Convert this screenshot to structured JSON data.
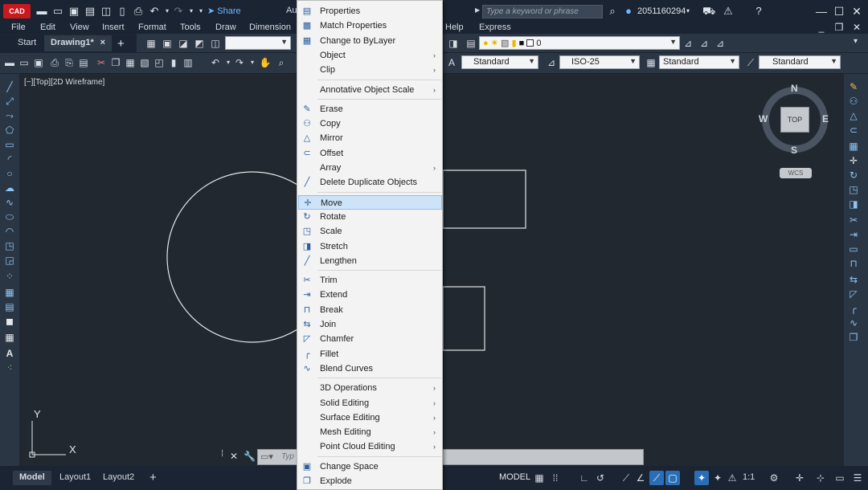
{
  "app": {
    "logo_text": "CAD",
    "title_fragment": "Au",
    "share_label": "Share",
    "search_placeholder": "Type a keyword or phrase",
    "user_id": "2051160294"
  },
  "menubar": [
    "File",
    "Edit",
    "View",
    "Insert",
    "Format",
    "Tools",
    "Draw",
    "Dimension",
    "Help",
    "Express"
  ],
  "tabs": {
    "start": "Start",
    "drawing": "Drawing1*",
    "close": "×",
    "add": "+"
  },
  "toolbar": {
    "layer_value": "0",
    "text_style": "Standard",
    "dim_style": "ISO-25",
    "table_style": "Standard",
    "multileader_style": "Standard"
  },
  "viewport_label": "[−][Top][2D Wireframe]",
  "viewcube": {
    "north": "N",
    "south": "S",
    "east": "E",
    "west": "W",
    "face": "TOP",
    "wcs": "WCS"
  },
  "ucs": {
    "x": "X",
    "y": "Y"
  },
  "command_line": {
    "placeholder": "Typ"
  },
  "layout_tabs": [
    "Model",
    "Layout1",
    "Layout2"
  ],
  "status": {
    "model": "MODEL",
    "scale": "1:1"
  },
  "context_menu": {
    "items": [
      {
        "label": "Properties",
        "icon": "properties-icon",
        "glyph": "▤",
        "submenu": false
      },
      {
        "label": "Match Properties",
        "icon": "match-properties-icon",
        "glyph": "▩",
        "submenu": false
      },
      {
        "label": "Change to ByLayer",
        "icon": "bylayer-icon",
        "glyph": "▦",
        "submenu": false
      },
      {
        "label": "Object",
        "icon": "",
        "glyph": "",
        "submenu": true
      },
      {
        "label": "Clip",
        "icon": "",
        "glyph": "",
        "submenu": true
      },
      {
        "label": "Annotative Object Scale",
        "icon": "",
        "glyph": "",
        "submenu": true
      },
      {
        "label": "Erase",
        "icon": "eraser-icon",
        "glyph": "✎",
        "submenu": false
      },
      {
        "label": "Copy",
        "icon": "copy-icon",
        "glyph": "⚇",
        "submenu": false
      },
      {
        "label": "Mirror",
        "icon": "mirror-icon",
        "glyph": "△",
        "submenu": false
      },
      {
        "label": "Offset",
        "icon": "offset-icon",
        "glyph": "⊂",
        "submenu": false
      },
      {
        "label": "Array",
        "icon": "",
        "glyph": "",
        "submenu": true
      },
      {
        "label": "Delete Duplicate Objects",
        "icon": "overkill-icon",
        "glyph": "╱",
        "submenu": false
      },
      {
        "label": "Move",
        "icon": "move-icon",
        "glyph": "✛",
        "submenu": false
      },
      {
        "label": "Rotate",
        "icon": "rotate-icon",
        "glyph": "↻",
        "submenu": false
      },
      {
        "label": "Scale",
        "icon": "scale-icon",
        "glyph": "◳",
        "submenu": false
      },
      {
        "label": "Stretch",
        "icon": "stretch-icon",
        "glyph": "◨",
        "submenu": false
      },
      {
        "label": "Lengthen",
        "icon": "lengthen-icon",
        "glyph": "╱",
        "submenu": false
      },
      {
        "label": "Trim",
        "icon": "trim-icon",
        "glyph": "✂",
        "submenu": false
      },
      {
        "label": "Extend",
        "icon": "extend-icon",
        "glyph": "⇥",
        "submenu": false
      },
      {
        "label": "Break",
        "icon": "break-icon",
        "glyph": "⊓",
        "submenu": false
      },
      {
        "label": "Join",
        "icon": "join-icon",
        "glyph": "⇆",
        "submenu": false
      },
      {
        "label": "Chamfer",
        "icon": "chamfer-icon",
        "glyph": "◸",
        "submenu": false
      },
      {
        "label": "Fillet",
        "icon": "fillet-icon",
        "glyph": "╭",
        "submenu": false
      },
      {
        "label": "Blend Curves",
        "icon": "blend-curves-icon",
        "glyph": "∿",
        "submenu": false
      },
      {
        "label": "3D Operations",
        "icon": "",
        "glyph": "",
        "submenu": true
      },
      {
        "label": "Solid Editing",
        "icon": "",
        "glyph": "",
        "submenu": true
      },
      {
        "label": "Surface Editing",
        "icon": "",
        "glyph": "",
        "submenu": true
      },
      {
        "label": "Mesh Editing",
        "icon": "",
        "glyph": "",
        "submenu": true
      },
      {
        "label": "Point Cloud Editing",
        "icon": "",
        "glyph": "",
        "submenu": true
      },
      {
        "label": "Change Space",
        "icon": "change-space-icon",
        "glyph": "▣",
        "submenu": false
      },
      {
        "label": "Explode",
        "icon": "explode-icon",
        "glyph": "❐",
        "submenu": false
      }
    ],
    "highlighted": "Move",
    "submenu_arrow": "›"
  },
  "colors": {
    "canvas": "#212830",
    "chrome": "#1b2432",
    "accent": "#2a6fb6",
    "highlight": "#cde3f7"
  }
}
